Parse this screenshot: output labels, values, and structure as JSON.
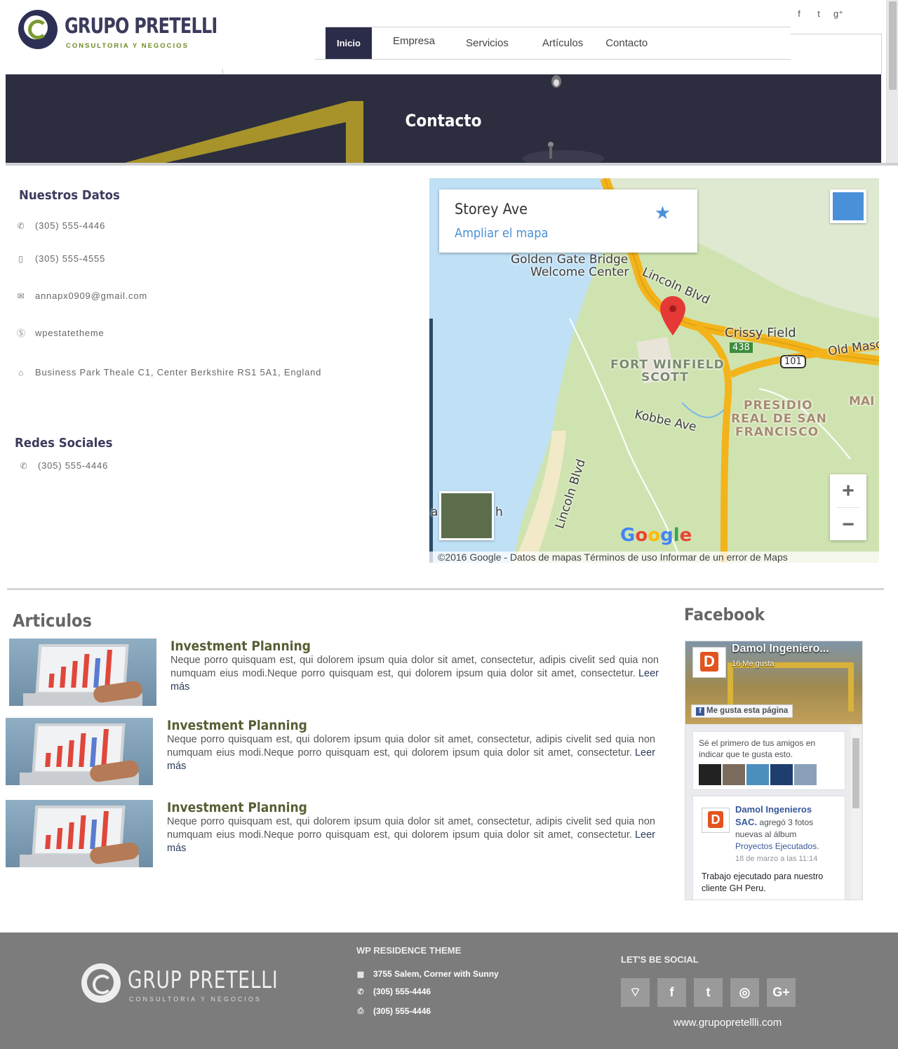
{
  "header": {
    "logo_name": "GRUPO PRETELLI",
    "logo_tagline": "CONSULTORIA Y NEGOCIOS",
    "social_icons": [
      "facebook-icon",
      "twitter-icon",
      "google-plus-icon"
    ],
    "social_glyphs": [
      "f",
      "t",
      "g⁺"
    ],
    "nav": [
      "Inicio",
      "Empresa",
      "Servicios",
      "Artículos",
      "Contacto"
    ],
    "active_nav": "Inicio"
  },
  "banner": {
    "title": "Contacto"
  },
  "contact": {
    "heading": "Nuestros Datos",
    "phone": "(305) 555-4446",
    "mobile": "(305) 555-4555",
    "email": "annapx0909@gmail.com",
    "skype": "wpestatetheme",
    "address": "Business Park Theale C1, Center Berkshire RS1 5A1, England"
  },
  "social_section": {
    "heading": "Redes Sociales",
    "phone": "(305) 555-4446"
  },
  "map": {
    "place": "Storey Ave",
    "expand_link": "Ampliar el mapa",
    "labels": {
      "gg1": "Golden Gate Bridge",
      "gg2": "Welcome Center",
      "lincoln": "Lincoln Blvd",
      "crissy": "Crissy Field",
      "r438": "438",
      "r101": "101",
      "oldmason": "Old Maso",
      "fw1": "FORT WINFIELD",
      "fw2": "SCOTT",
      "presidio1": "PRESIDIO",
      "presidio2": "REAL DE SAN",
      "presidio3": "FRANCISCO",
      "mai": "MAI",
      "kobbe": "Kobbe Ave",
      "lincoln2": "Lincoln Blvd",
      "beach_a": "a",
      "beach_h": "h"
    },
    "attribution": "©2016 Google - Datos de mapas     Términos de uso   Informar de un error de Maps",
    "google_letters": [
      "G",
      "o",
      "o",
      "g",
      "l",
      "e"
    ],
    "zoom_in": "+",
    "zoom_out": "−"
  },
  "articles": {
    "heading": "Articulos",
    "items": [
      {
        "title": "Investment Planning",
        "text": "Neque porro quisquam est, qui dolorem ipsum quia dolor sit amet, consectetur, adipis civelit sed quia non numquam eius modi.Neque porro quisquam est, qui dolorem ipsum quia dolor sit amet, consectetur.",
        "more": "Leer más"
      },
      {
        "title": "Investment Planning",
        "text": "Neque porro quisquam est, qui dolorem ipsum quia dolor sit amet, consectetur, adipis civelit sed quia non numquam eius modi.Neque porro quisquam est, qui dolorem ipsum quia dolor sit amet, consectetur.",
        "more": "Leer más"
      },
      {
        "title": "Investment Planning",
        "text": "Neque porro quisquam est, qui dolorem ipsum quia dolor sit amet, consectetur, adipis civelit sed quia non numquam eius modi.Neque porro quisquam est, qui dolorem ipsum quia dolor sit amet, consectetur.",
        "more": "Leer más"
      }
    ]
  },
  "facebook": {
    "heading": "Facebook",
    "page_name": "Damol Ingeniero...",
    "likes": "16 Me gusta",
    "like_button": "Me gusta esta página",
    "friends_text": "Sé el primero de tus amigos en indicar que te gusta esto.",
    "post_author": "Damol Ingenieros SAC.",
    "post_action": "agregó 3 fotos nuevas al álbum",
    "post_album": "Proyectos Ejecutados.",
    "post_date": "18 de marzo a las 11:14",
    "post_text": "Trabajo ejecutado para nuestro cliente GH Peru."
  },
  "footer": {
    "logo_name": "GRUP  PRETELLI",
    "logo_tagline": "CONSULTORIA Y NEGOCIOS",
    "theme_heading": "WP RESIDENCE THEME",
    "address": "3755 Salem, Corner with Sunny",
    "phone": "(305) 555-4446",
    "fax": "(305) 555-4446",
    "social_heading": "LET'S BE SOCIAL",
    "social_icons": [
      "rss-icon",
      "facebook-icon",
      "twitter-icon",
      "dribbble-icon",
      "google-plus-icon"
    ],
    "social_glyphs": [
      "⌔",
      "f",
      "t",
      "◎",
      "G+"
    ],
    "url": "www.grupopretellli.com"
  },
  "colors": {
    "brand_dark": "#2b2c49",
    "brand_green": "#7a9b2e",
    "banner": "#2c2e3f",
    "footer": "#7c7c7c",
    "gold": "#a8932a"
  }
}
